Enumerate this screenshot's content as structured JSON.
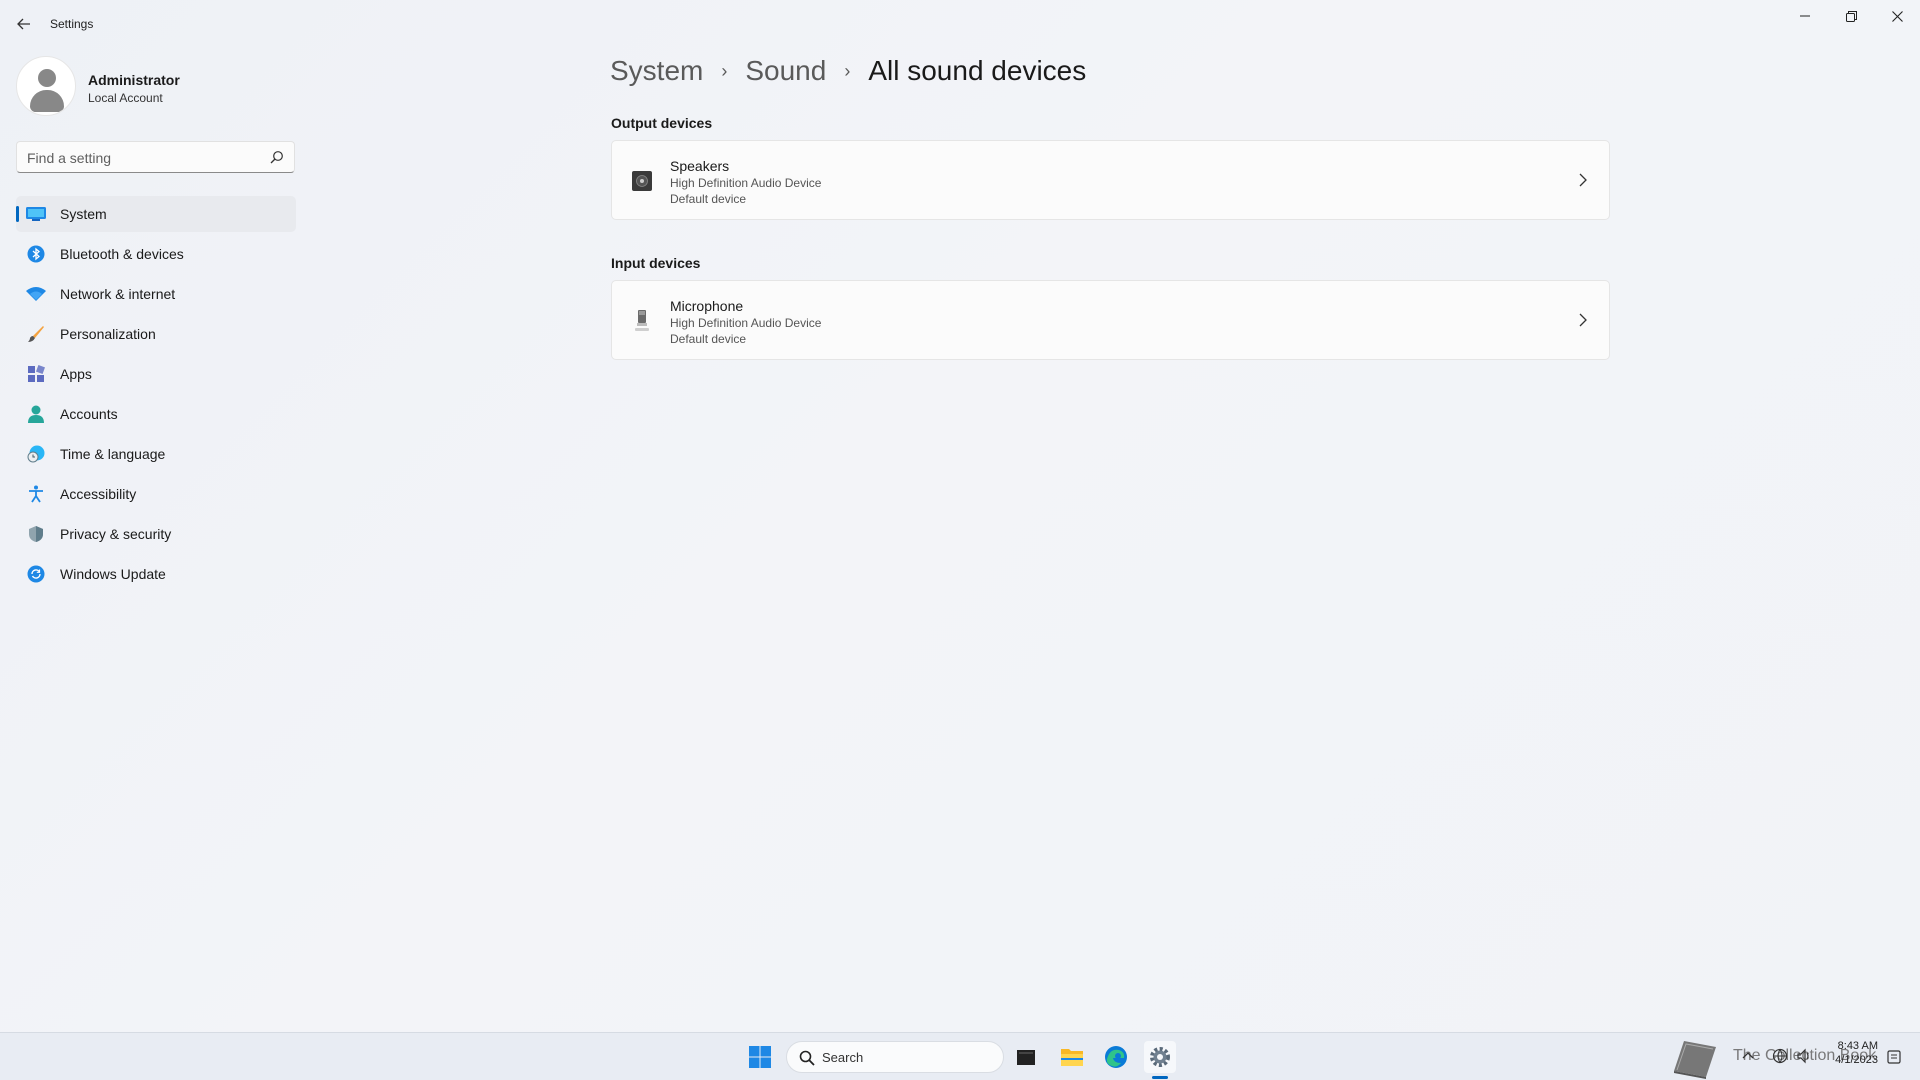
{
  "app": {
    "title": "Settings"
  },
  "window_controls": {
    "minimize": "—",
    "maximize": "❐",
    "close": "✕"
  },
  "profile": {
    "name": "Administrator",
    "account_type": "Local Account"
  },
  "search": {
    "placeholder": "Find a setting"
  },
  "nav": {
    "items": [
      {
        "label": "System",
        "icon": "system-icon",
        "active": true
      },
      {
        "label": "Bluetooth & devices",
        "icon": "bluetooth-icon"
      },
      {
        "label": "Network & internet",
        "icon": "wifi-icon"
      },
      {
        "label": "Personalization",
        "icon": "brush-icon"
      },
      {
        "label": "Apps",
        "icon": "apps-icon"
      },
      {
        "label": "Accounts",
        "icon": "accounts-icon"
      },
      {
        "label": "Time & language",
        "icon": "time-language-icon"
      },
      {
        "label": "Accessibility",
        "icon": "accessibility-icon"
      },
      {
        "label": "Privacy & security",
        "icon": "shield-icon"
      },
      {
        "label": "Windows Update",
        "icon": "update-icon"
      }
    ]
  },
  "breadcrumb": {
    "level1": "System",
    "level2": "Sound",
    "current": "All sound devices",
    "separator": "›"
  },
  "output": {
    "title": "Output devices",
    "device": {
      "name": "Speakers",
      "description": "High Definition Audio Device",
      "status": "Default device",
      "icon": "speaker-icon"
    }
  },
  "input": {
    "title": "Input devices",
    "device": {
      "name": "Microphone",
      "description": "High Definition Audio Device",
      "status": "Default device",
      "icon": "microphone-icon"
    }
  },
  "taskbar": {
    "search_label": "Search",
    "watermark": "The Collection Book",
    "time": "8:43 AM",
    "date": "4/1/2023"
  },
  "colors": {
    "accent": "#0067c0",
    "background": "#f3f3f3"
  }
}
